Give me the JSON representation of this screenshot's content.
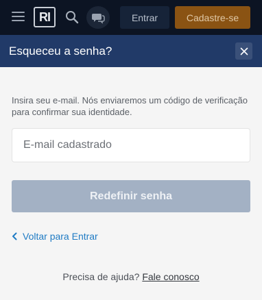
{
  "navbar": {
    "logo_text": "RI",
    "login_label": "Entrar",
    "signup_label": "Cadastre-se",
    "colors": {
      "background": "#0c1423",
      "signup_bg": "#8a5313",
      "login_bg": "#162338"
    }
  },
  "modal": {
    "title": "Esqueceu a senha?",
    "close_icon": "close-icon",
    "description": "Insira seu e-mail. Nós enviaremos um código de verificação para confirmar sua identidade.",
    "email": {
      "placeholder": "E-mail cadastrado",
      "value": ""
    },
    "submit_label": "Redefinir senha",
    "back_label": "Voltar para Entrar",
    "help_prefix": "Precisa de ajuda?",
    "help_link": "Fale conosco",
    "colors": {
      "header": "#213a68",
      "submit_disabled": "#a3b1c4",
      "link": "#1f7bc4"
    }
  }
}
